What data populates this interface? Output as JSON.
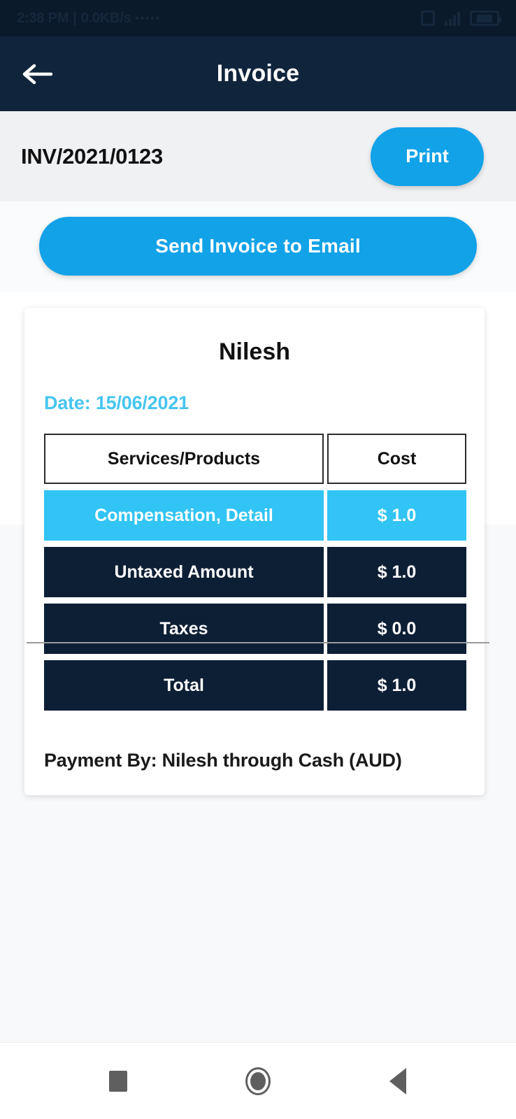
{
  "status_bar": {
    "time": "2:38 PM",
    "separator": "|",
    "network_speed": "0.0KB/s",
    "dots": "•••••",
    "icons": {
      "sd_card": "sd-card-icon",
      "signal": "signal-bars-icon",
      "battery": "battery-icon"
    }
  },
  "app_bar": {
    "back_icon": "back-arrow-icon",
    "title": "Invoice"
  },
  "invoice_bar": {
    "invoice_number": "INV/2021/0123",
    "print_label": "Print"
  },
  "actions": {
    "send_invoice_label": "Send Invoice to Email"
  },
  "invoice_card": {
    "customer_name": "Nilesh",
    "date_label": "Date: 15/06/2021",
    "table": {
      "headers": [
        "Services/Products",
        "Cost"
      ],
      "rows": [
        {
          "service": "Compensation, Detail",
          "cost": "$ 1.0",
          "style": "highlight"
        },
        {
          "service": "Untaxed Amount",
          "cost": "$ 1.0",
          "style": "dark"
        },
        {
          "service": "Taxes",
          "cost": "$ 0.0",
          "style": "dark"
        },
        {
          "service": "Total",
          "cost": "$ 1.0",
          "style": "dark"
        }
      ]
    },
    "payment_line": "Payment By: Nilesh through Cash (AUD)"
  },
  "nav_bar": {
    "recents": "recents-square-icon",
    "home": "home-circle-icon",
    "back": "back-triangle-icon"
  },
  "colors": {
    "accent_blue": "#11a2e8",
    "highlight_cyan": "#31c4f4",
    "dark_navy": "#0d1f35",
    "app_bar_navy": "#10253c",
    "date_blue": "#46c5f0",
    "page_bg": "#f8f9fa"
  }
}
